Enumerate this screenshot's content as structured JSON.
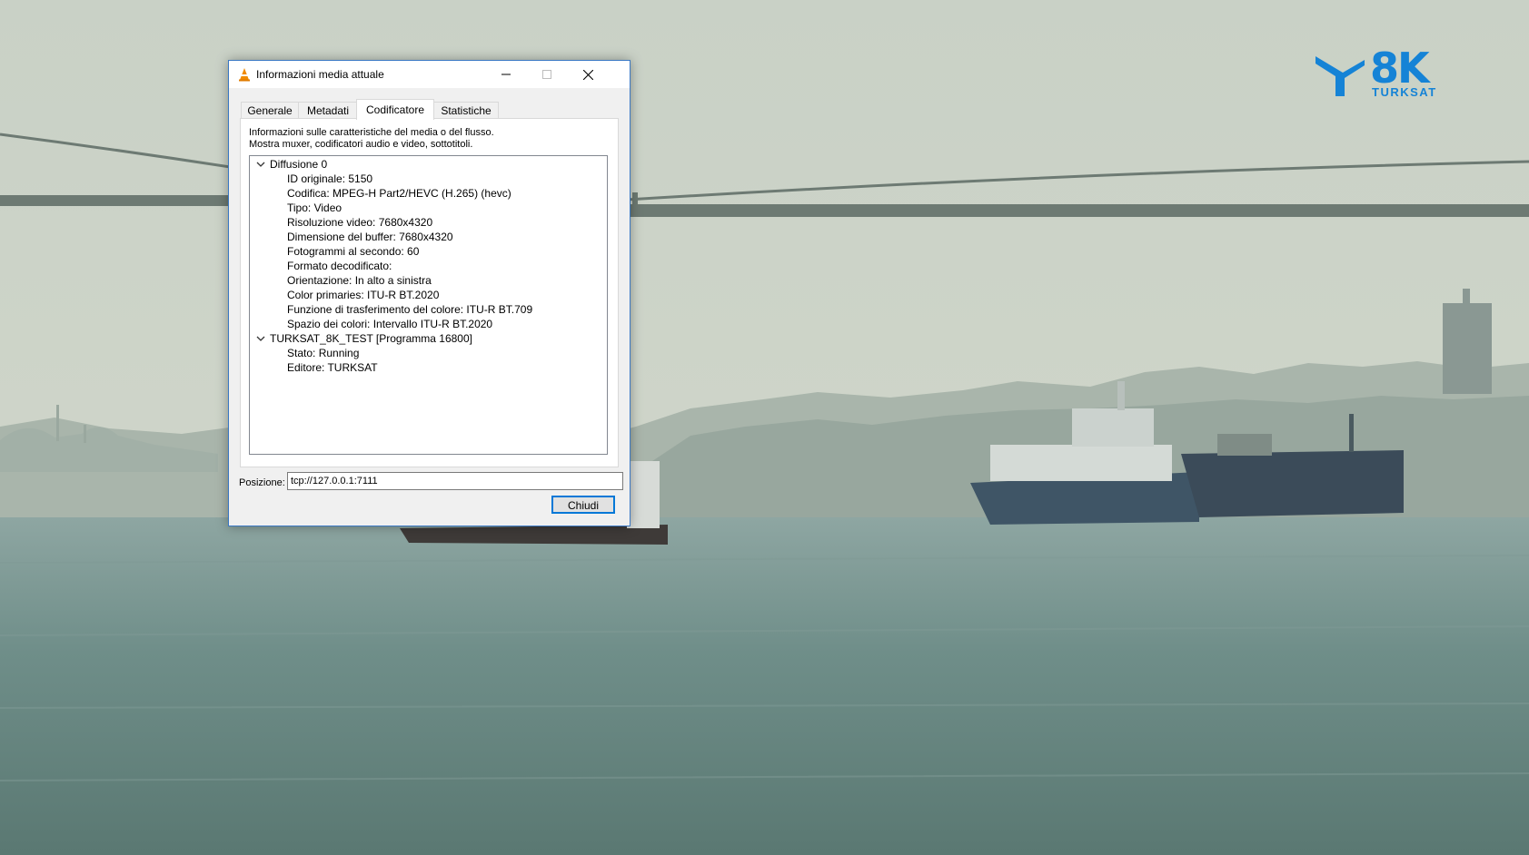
{
  "logo": {
    "text": "8K",
    "subtext": "TURKSAT",
    "color": "#1583d6"
  },
  "dialog": {
    "title": "Informazioni media attuale",
    "app_icon": "vlc-cone-icon",
    "window_controls": {
      "minimize": "minimize-icon",
      "maximize": "maximize-icon",
      "close": "close-icon"
    },
    "tabs": [
      {
        "label": "Generale",
        "active": false
      },
      {
        "label": "Metadati",
        "active": false
      },
      {
        "label": "Codificatore",
        "active": true
      },
      {
        "label": "Statistiche",
        "active": false
      }
    ],
    "description": {
      "line1": "Informazioni sulle caratteristiche del media o del flusso.",
      "line2": "Mostra muxer, codificatori audio e video, sottotitoli."
    },
    "tree": {
      "stream0": {
        "label": "Diffusione 0",
        "items": [
          "ID originale: 5150",
          "Codifica: MPEG-H Part2/HEVC (H.265) (hevc)",
          "Tipo: Video",
          "Risoluzione video: 7680x4320",
          "Dimensione del buffer: 7680x4320",
          "Fotogrammi al secondo: 60",
          "Formato decodificato:",
          "Orientazione: In alto a sinistra",
          "Color primaries: ITU-R BT.2020",
          "Funzione di trasferimento del colore: ITU-R BT.709",
          "Spazio dei colori: Intervallo ITU-R BT.2020"
        ]
      },
      "program": {
        "label": "TURKSAT_8K_TEST [Programma 16800]",
        "items": [
          "Stato: Running",
          "Editore: TURKSAT"
        ]
      }
    },
    "position": {
      "label": "Posizione:",
      "value": "tcp://127.0.0.1:7111"
    },
    "close_label": "Chiudi"
  },
  "colors": {
    "accent": "#0078d7",
    "window_border": "#3a78c4",
    "logo": "#1583d6"
  }
}
